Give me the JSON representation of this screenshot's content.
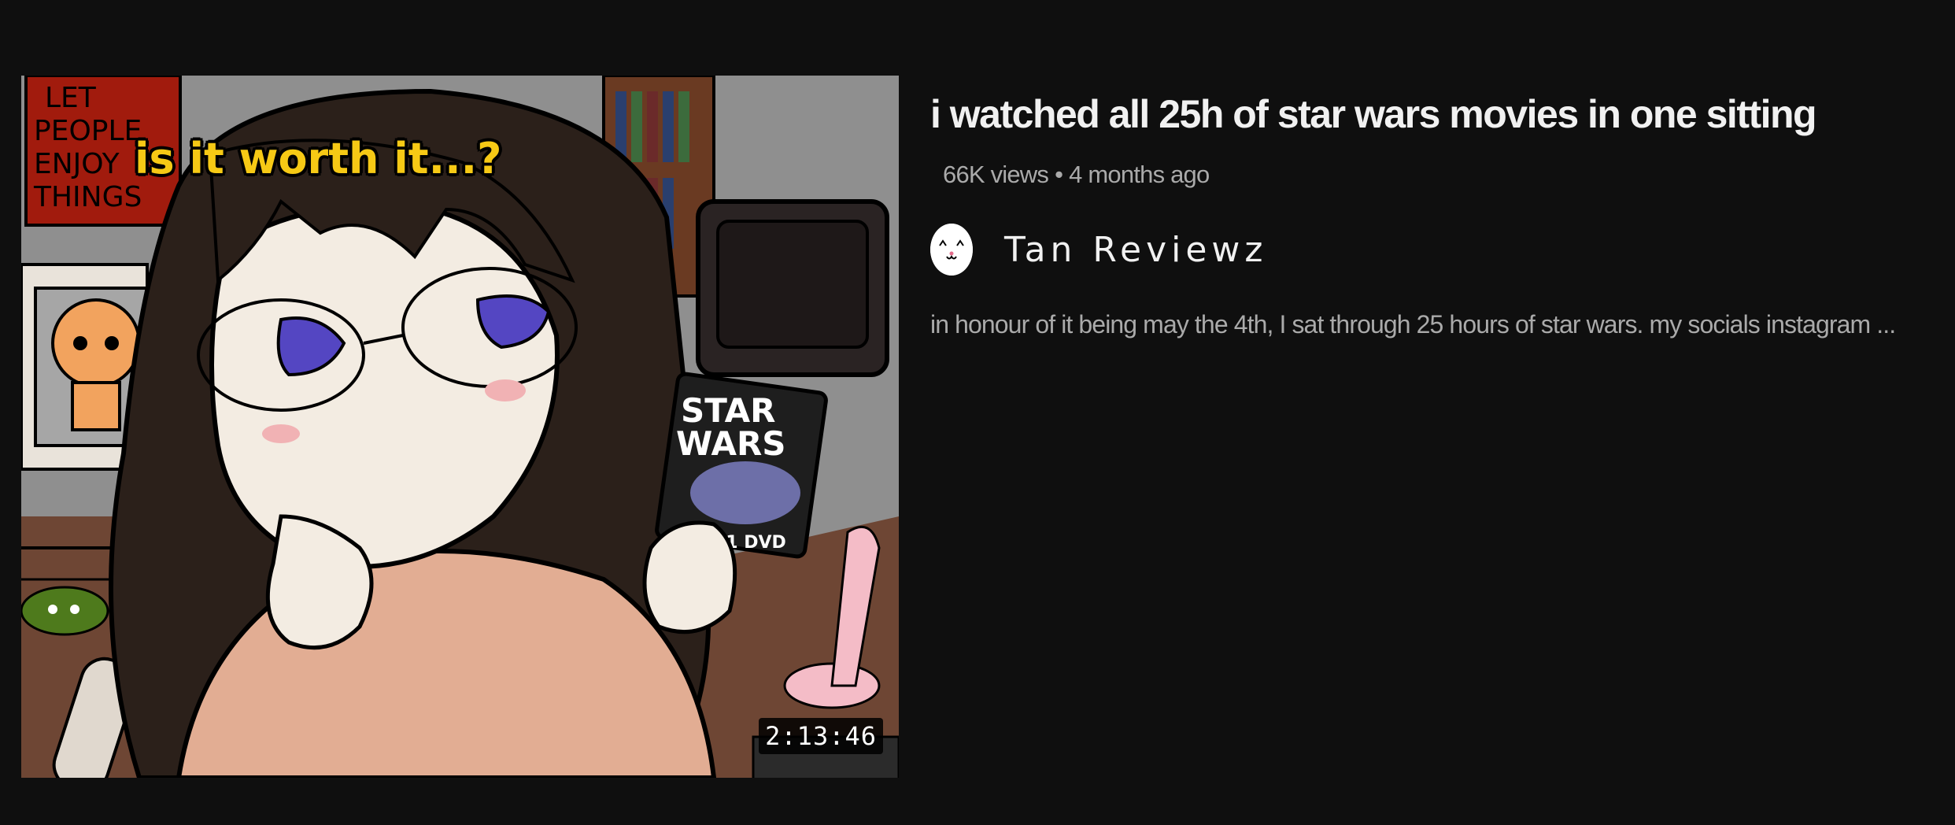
{
  "video": {
    "title": "i watched all 25h of star wars movies in one sitting",
    "views": "66K views",
    "separator": "•",
    "age": "4 months ago",
    "duration": "2:13:46",
    "thumbnail_overlay_text": "is it worth it...?",
    "thumbnail_poster_text": [
      "LET",
      "PEOPLE",
      "ENJOY",
      "THINGS"
    ],
    "thumbnail_dvd_text": [
      "STAR",
      "WARS",
      "9 IN 1 DVD"
    ],
    "description": "in honour of it being may the 4th, I sat through 25 hours of star wars. my socials instagram ..."
  },
  "channel": {
    "name": "Tan Reviewz",
    "avatar_icon": "cat-face-icon"
  },
  "colors": {
    "background": "#0f0f0f",
    "title": "#f1f1f1",
    "secondary_text": "#aaaaaa",
    "overlay_text": "#f6c915"
  }
}
